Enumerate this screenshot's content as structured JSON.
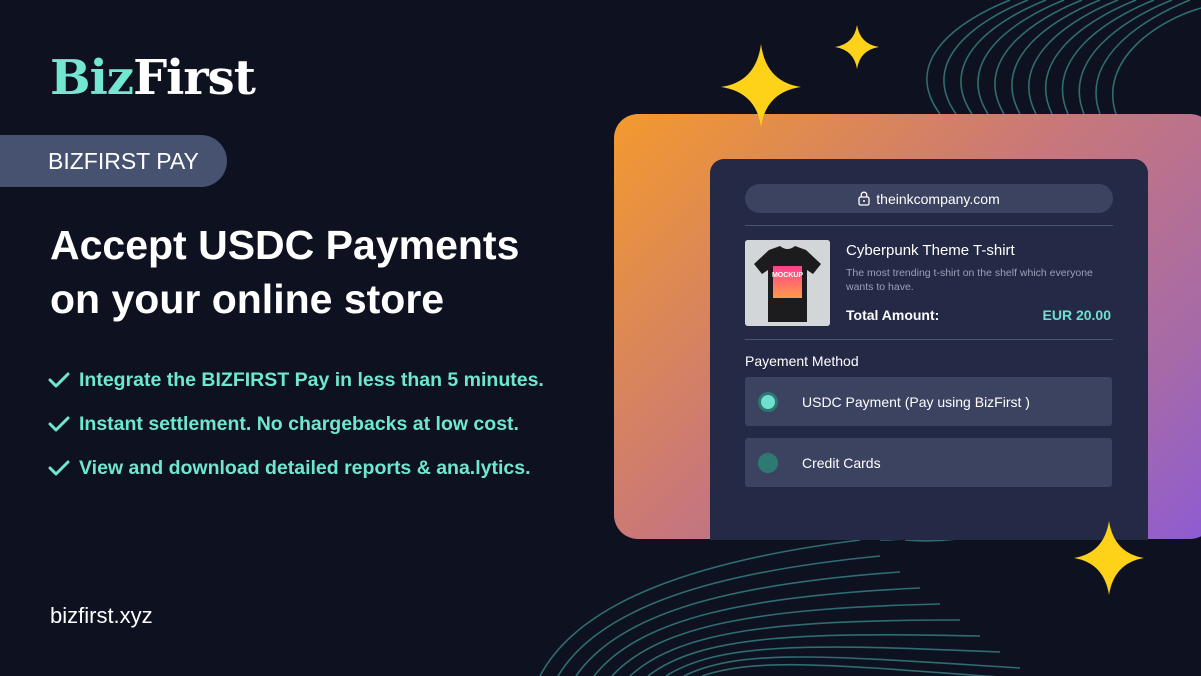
{
  "brand": {
    "logo_part1": "Biz",
    "logo_part2": "First"
  },
  "tag": "BIZFIRST PAY",
  "headline": {
    "line1": "Accept USDC Payments",
    "line2": "on your online store"
  },
  "features": [
    "Integrate the BIZFIRST Pay in less than 5 minutes.",
    "Instant settlement. No chargebacks at low cost.",
    "View and download detailed reports & ana.lytics."
  ],
  "website": "bizfirst.xyz",
  "checkout": {
    "url": "theinkcompany.com",
    "product": {
      "image_label": "MOCKUP",
      "title": "Cyberpunk Theme T-shirt",
      "description": "The most trending t-shirt on the shelf which everyone wants to have.",
      "total_label": "Total Amount:",
      "total_value": "EUR 20.00"
    },
    "payment_method_title": "Payement Method",
    "options": [
      {
        "label": "USDC Payment (Pay using BizFirst )",
        "selected": true
      },
      {
        "label": "Credit Cards",
        "selected": false
      }
    ]
  },
  "icons": [
    "lock-icon",
    "check-icon",
    "radio-icon",
    "sparkle-icon"
  ],
  "colors": {
    "background": "#0e1120",
    "accent": "#6fe7d0",
    "tag_bg": "#475270",
    "card_gradient": [
      "#f39a2e",
      "#c8777a",
      "#8d5bd4"
    ],
    "panel": "#242a46",
    "sparkle": "#ffd21a"
  }
}
